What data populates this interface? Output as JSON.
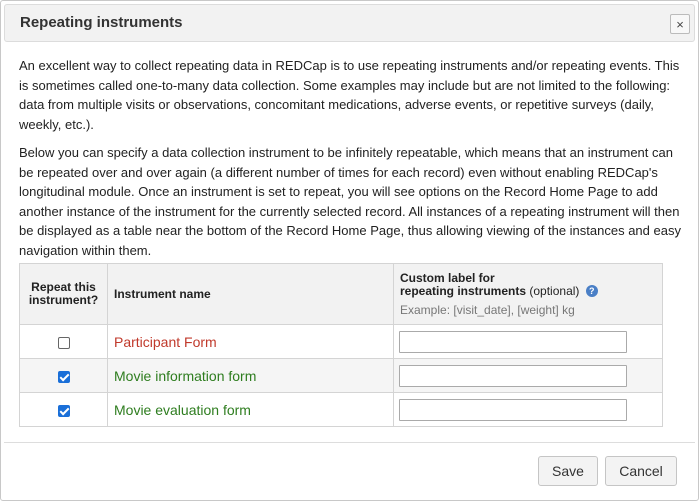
{
  "dialog": {
    "title": "Repeating instruments",
    "close_icon": "×"
  },
  "intro": {
    "paragraph1": "An excellent way to collect repeating data in REDCap is to use repeating instruments and/or repeating events. This is sometimes called one-to-many data collection. Some examples may include but are not limited to the following: data from multiple visits or observations, concomitant medications, adverse events, or repetitive surveys (daily, weekly, etc.).",
    "paragraph2": "Below you can specify a data collection instrument to be infinitely repeatable, which means that an instrument can be repeated over and over again (a different number of times for each record) even without enabling REDCap's longitudinal module. Once an instrument is set to repeat, you will see options on the Record Home Page to add another instance of the instrument for the currently selected record. All instances of a repeating instrument will then be displayed as a table near the bottom of the Record Home Page, thus allowing viewing of the instances and easy navigation within them."
  },
  "table": {
    "headers": {
      "repeat": "Repeat this instrument?",
      "name": "Instrument name",
      "label_line1": "Custom label for",
      "label_line2": "repeating instruments",
      "label_optional": "(optional)",
      "label_example": "Example: [visit_date], [weight] kg",
      "help_icon": "?"
    },
    "rows": [
      {
        "name": "Participant Form",
        "checked": false,
        "name_color": "#c0392b",
        "label_value": ""
      },
      {
        "name": "Movie information form",
        "checked": true,
        "name_color": "#2e7d1f",
        "label_value": ""
      },
      {
        "name": "Movie evaluation form",
        "checked": true,
        "name_color": "#2e7d1f",
        "label_value": ""
      }
    ]
  },
  "footer": {
    "save_label": "Save",
    "cancel_label": "Cancel"
  }
}
